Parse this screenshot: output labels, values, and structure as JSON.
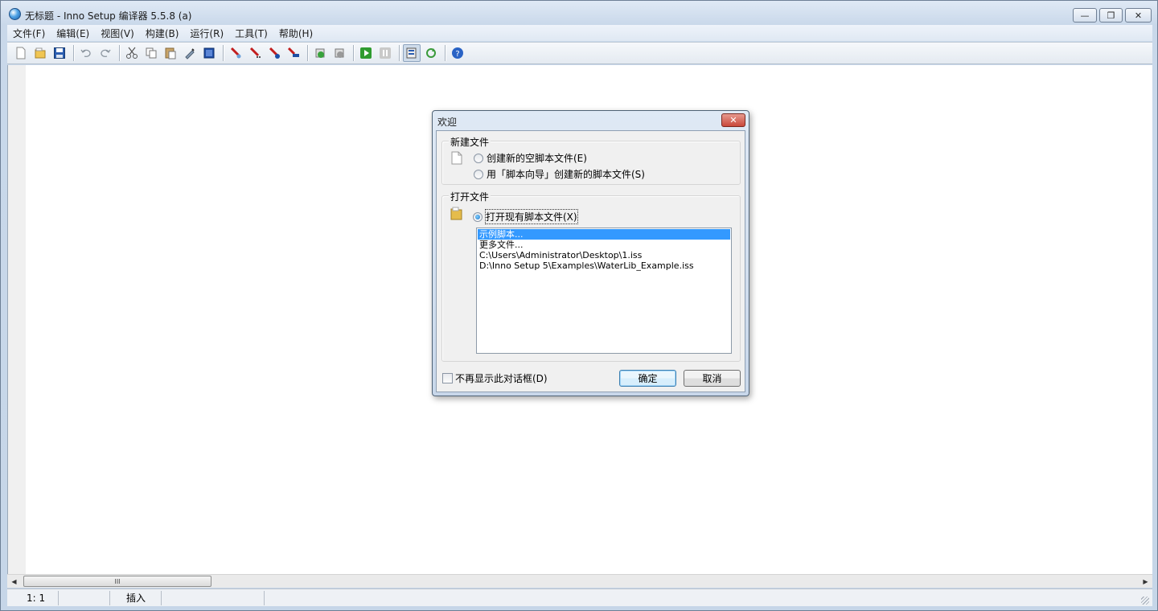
{
  "window": {
    "title": "无标题 - Inno Setup 编译器 5.5.8 (a)",
    "minimize_label": "▭",
    "maximize_label": "▣",
    "close_label": "✕"
  },
  "menu": {
    "items": [
      "文件(F)",
      "编辑(E)",
      "视图(V)",
      "构建(B)",
      "运行(R)",
      "工具(T)",
      "帮助(H)"
    ]
  },
  "toolbar": {
    "icons": [
      "new-file-icon",
      "open-file-icon",
      "save-icon",
      "undo-icon",
      "redo-icon",
      "cut-icon",
      "copy-icon",
      "paste-icon",
      "find-icon",
      "select-all-icon",
      "compile-icon",
      "stop-compile-icon",
      "breakpoint-icon",
      "step-icon",
      "target-setup-icon",
      "target-uninstall-icon",
      "run-icon",
      "pause-icon",
      "compile-options-icon",
      "refresh-icon",
      "help-icon"
    ]
  },
  "scrollbar": {
    "thumb_grip": "III"
  },
  "status": {
    "position": "1:  1",
    "mode": "插入"
  },
  "dialog": {
    "title": "欢迎",
    "close_label": "✕",
    "new_file_group": {
      "legend": "新建文件",
      "option_empty": "创建新的空脚本文件(E)",
      "option_wizard": "用「脚本向导」创建新的脚本文件(S)"
    },
    "open_file_group": {
      "legend": "打开文件",
      "option_existing": "打开现有脚本文件(X)",
      "files": [
        "示例脚本...",
        "更多文件...",
        "C:\\Users\\Administrator\\Desktop\\1.iss",
        "D:\\Inno Setup 5\\Examples\\WaterLib_Example.iss"
      ],
      "selected_index": 0
    },
    "dont_show_label": "不再显示此对话框(D)",
    "ok_label": "确定",
    "cancel_label": "取消"
  },
  "colors": {
    "selection": "#3399ff",
    "title_bar": "#c9d8ea",
    "dialog_close": "#c9473a"
  }
}
